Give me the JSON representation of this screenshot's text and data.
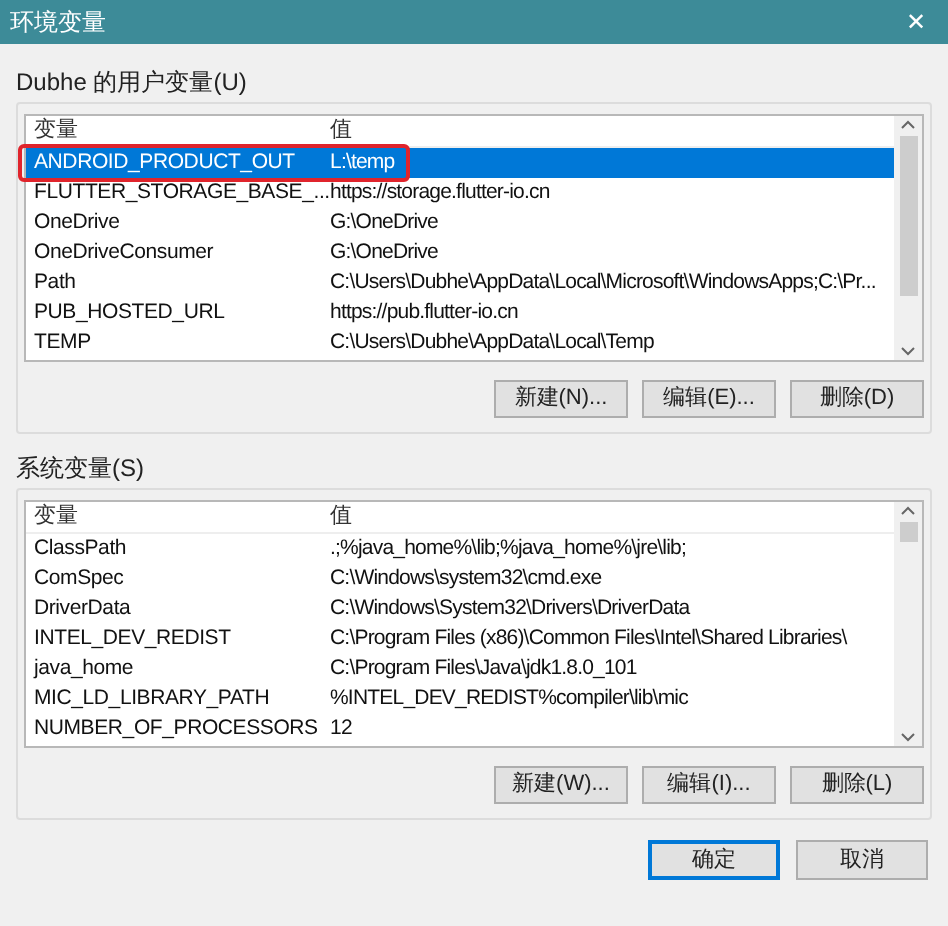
{
  "window": {
    "title": "环境变量",
    "close": "✕"
  },
  "user_vars": {
    "label": "Dubhe 的用户变量(U)",
    "columns": [
      "变量",
      "值"
    ],
    "rows": [
      {
        "name": "ANDROID_PRODUCT_OUT",
        "value": "L:\\temp",
        "selected": true
      },
      {
        "name": "FLUTTER_STORAGE_BASE_...",
        "value": "https://storage.flutter-io.cn",
        "selected": false
      },
      {
        "name": "OneDrive",
        "value": "G:\\OneDrive",
        "selected": false
      },
      {
        "name": "OneDriveConsumer",
        "value": "G:\\OneDrive",
        "selected": false
      },
      {
        "name": "Path",
        "value": "C:\\Users\\Dubhe\\AppData\\Local\\Microsoft\\WindowsApps;C:\\Pr...",
        "selected": false
      },
      {
        "name": "PUB_HOSTED_URL",
        "value": "https://pub.flutter-io.cn",
        "selected": false
      },
      {
        "name": "TEMP",
        "value": "C:\\Users\\Dubhe\\AppData\\Local\\Temp",
        "selected": false
      }
    ],
    "buttons": [
      "新建(N)...",
      "编辑(E)...",
      "删除(D)"
    ]
  },
  "system_vars": {
    "label": "系统变量(S)",
    "columns": [
      "变量",
      "值"
    ],
    "rows": [
      {
        "name": "ClassPath",
        "value": ".;%java_home%\\lib;%java_home%\\jre\\lib;",
        "selected": false
      },
      {
        "name": "ComSpec",
        "value": "C:\\Windows\\system32\\cmd.exe",
        "selected": false
      },
      {
        "name": "DriverData",
        "value": "C:\\Windows\\System32\\Drivers\\DriverData",
        "selected": false
      },
      {
        "name": "INTEL_DEV_REDIST",
        "value": "C:\\Program Files (x86)\\Common Files\\Intel\\Shared Libraries\\",
        "selected": false
      },
      {
        "name": "java_home",
        "value": "C:\\Program Files\\Java\\jdk1.8.0_101",
        "selected": false
      },
      {
        "name": "MIC_LD_LIBRARY_PATH",
        "value": "%INTEL_DEV_REDIST%compiler\\lib\\mic",
        "selected": false
      },
      {
        "name": "NUMBER_OF_PROCESSORS",
        "value": "12",
        "selected": false
      }
    ],
    "buttons": [
      "新建(W)...",
      "编辑(I)...",
      "删除(L)"
    ]
  },
  "footer_buttons": [
    {
      "label": "确定",
      "kind": "default"
    },
    {
      "label": "取消",
      "kind": "normal"
    }
  ]
}
